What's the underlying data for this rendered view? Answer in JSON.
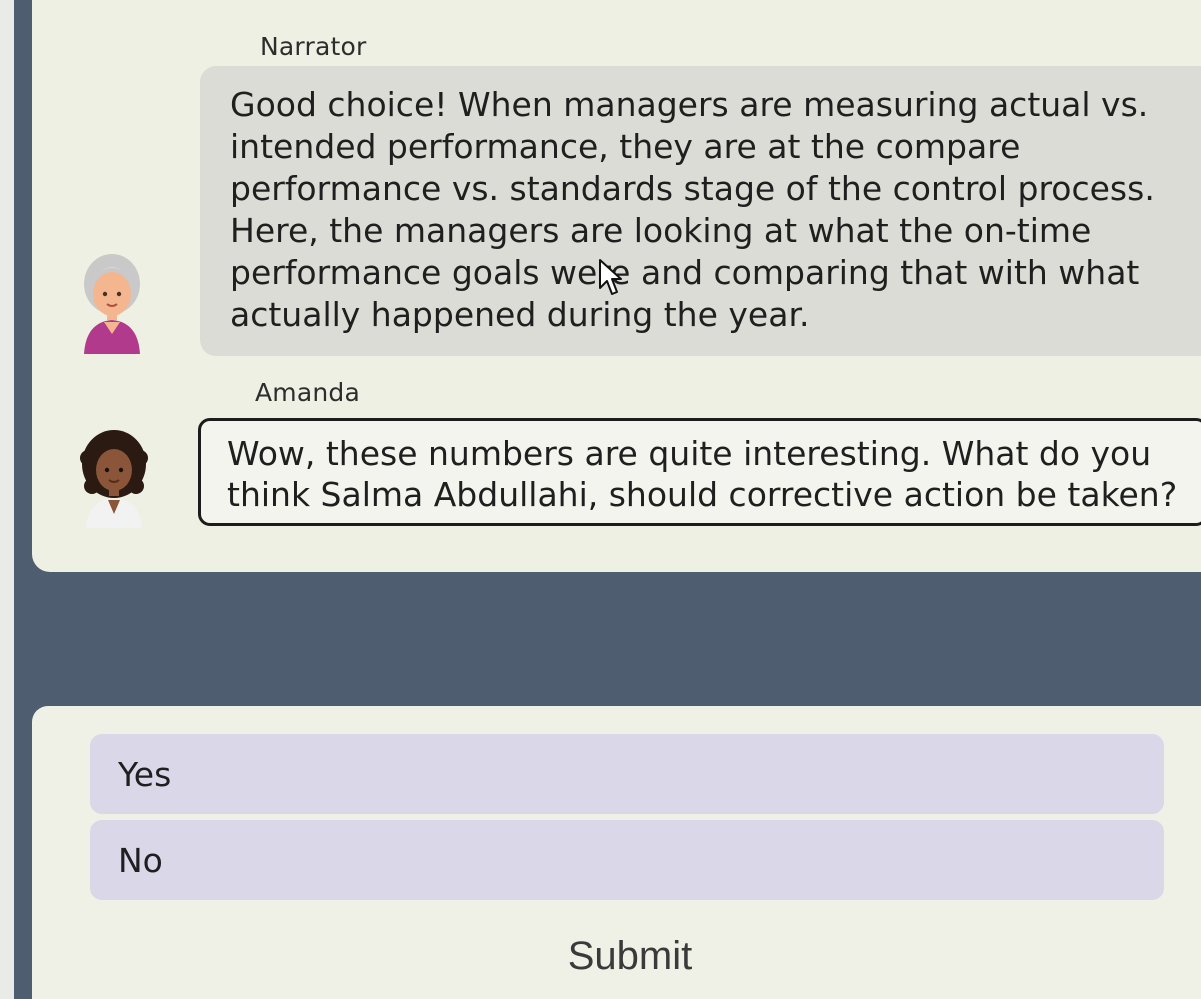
{
  "messages": [
    {
      "speaker": "Narrator",
      "avatar_icon": "elderly-woman-avatar",
      "text": "Good choice! When managers are measuring actual vs. intended performance, they are at the compare performance vs. standards stage of the control process. Here, the managers are looking at what the on-time performance goals were and comparing that with what actually happened during the year."
    },
    {
      "speaker": "Amanda",
      "avatar_icon": "woman-curly-hair-avatar",
      "text": "Wow, these numbers are quite interesting. What do you think Salma Abdullahi, should corrective action be taken?"
    }
  ],
  "options": [
    "Yes",
    "No"
  ],
  "submit_label": "Submit",
  "colors": {
    "background": "#4e5d70",
    "panel": "#eef0e3",
    "narrator_bubble": "#dcdcd6",
    "option_bg": "#d9d7e8"
  }
}
